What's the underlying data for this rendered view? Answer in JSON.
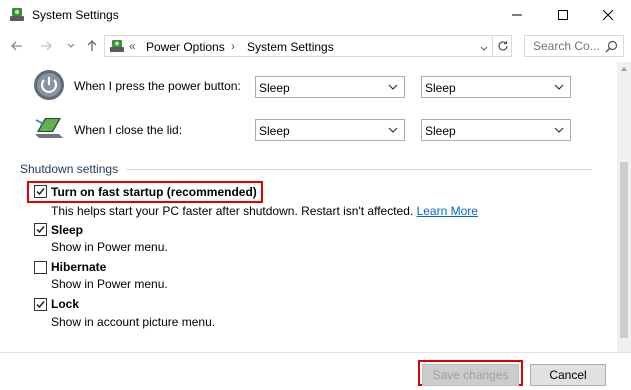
{
  "window": {
    "title": "System Settings",
    "minimize_glyph": "—",
    "maximize_glyph": "☐",
    "close_glyph": "✕"
  },
  "address": {
    "overflow": "«",
    "crumb1": "Power Options",
    "separator": "›",
    "crumb2": "System Settings",
    "search_placeholder": "Search Co..."
  },
  "power_rows": [
    {
      "label": "When I press the power button:",
      "battery_value": "Sleep",
      "plugged_value": "Sleep",
      "icon": "power-button-icon"
    },
    {
      "label": "When I close the lid:",
      "battery_value": "Sleep",
      "plugged_value": "Sleep",
      "icon": "laptop-lid-icon"
    }
  ],
  "shutdown": {
    "section_title": "Shutdown settings",
    "options": [
      {
        "label": "Turn on fast startup (recommended)",
        "description": "This helps start your PC faster after shutdown. Restart isn't affected.",
        "link": "Learn More",
        "checked": true
      },
      {
        "label": "Sleep",
        "description": "Show in Power menu.",
        "checked": true
      },
      {
        "label": "Hibernate",
        "description": "Show in Power menu.",
        "checked": false
      },
      {
        "label": "Lock",
        "description": "Show in account picture menu.",
        "checked": true
      }
    ]
  },
  "footer": {
    "save_label": "Save changes",
    "cancel_label": "Cancel"
  },
  "colors": {
    "highlight": "#e00000",
    "link": "#0066cc",
    "section_title": "#1e395b"
  }
}
